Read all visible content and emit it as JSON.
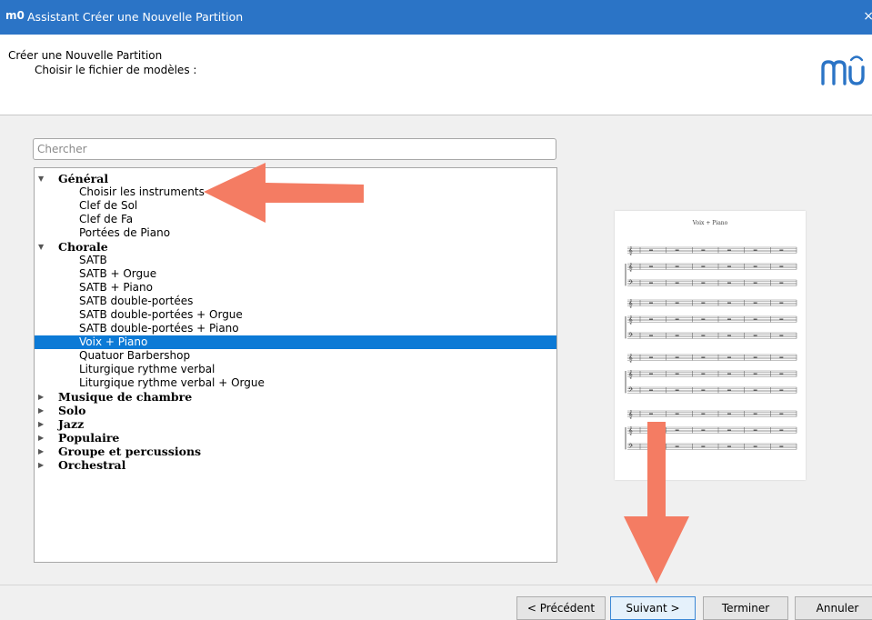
{
  "window": {
    "title": "Assistant Créer une Nouvelle Partition",
    "icon_text": "m0",
    "close_glyph": "×"
  },
  "header": {
    "title": "Créer une Nouvelle Partition",
    "subtitle": "Choisir le fichier de modèles :",
    "logo": "musescore-logo"
  },
  "search": {
    "placeholder": "Chercher",
    "value": ""
  },
  "tree": {
    "rows": [
      {
        "kind": "category",
        "label": "Général",
        "expanded": true
      },
      {
        "kind": "item",
        "label": "Choisir les instruments"
      },
      {
        "kind": "item",
        "label": "Clef de Sol"
      },
      {
        "kind": "item",
        "label": "Clef de Fa"
      },
      {
        "kind": "item",
        "label": "Portées de Piano"
      },
      {
        "kind": "category",
        "label": "Chorale",
        "expanded": true
      },
      {
        "kind": "item",
        "label": "SATB"
      },
      {
        "kind": "item",
        "label": "SATB + Orgue"
      },
      {
        "kind": "item",
        "label": "SATB + Piano"
      },
      {
        "kind": "item",
        "label": "SATB double-portées"
      },
      {
        "kind": "item",
        "label": "SATB double-portées + Orgue"
      },
      {
        "kind": "item",
        "label": "SATB double-portées + Piano"
      },
      {
        "kind": "item",
        "label": "Voix + Piano",
        "selected": true
      },
      {
        "kind": "item",
        "label": "Quatuor Barbershop"
      },
      {
        "kind": "item",
        "label": "Liturgique rythme verbal"
      },
      {
        "kind": "item",
        "label": "Liturgique rythme verbal + Orgue"
      },
      {
        "kind": "category",
        "label": "Musique de chambre",
        "expanded": false
      },
      {
        "kind": "category",
        "label": "Solo",
        "expanded": false
      },
      {
        "kind": "category",
        "label": "Jazz",
        "expanded": false
      },
      {
        "kind": "category",
        "label": "Populaire",
        "expanded": false
      },
      {
        "kind": "category",
        "label": "Groupe et percussions",
        "expanded": false
      },
      {
        "kind": "category",
        "label": "Orchestral",
        "expanded": false
      }
    ],
    "expanded_glyph": "▼",
    "collapsed_glyph": "▶"
  },
  "preview": {
    "title": "Voix + Piano"
  },
  "buttons": {
    "previous": "< Précédent",
    "next": "Suivant >",
    "finish": "Terminer",
    "cancel": "Annuler"
  },
  "colors": {
    "titlebar": "#2b74c6",
    "selection": "#0c7ad6",
    "annotation_arrow": "#f47c63"
  }
}
